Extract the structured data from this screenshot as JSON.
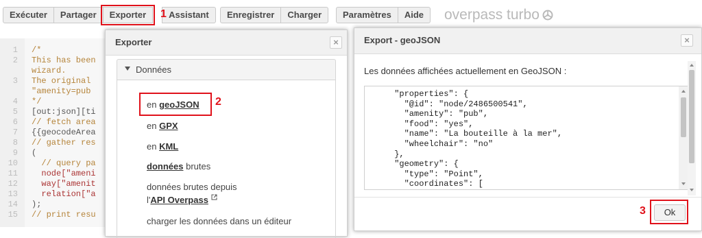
{
  "toolbar": {
    "run": "Exécuter",
    "share": "Partager",
    "export": "Exporter",
    "wizard": "Assistant",
    "save": "Enregistrer",
    "load": "Charger",
    "settings": "Paramètres",
    "help": "Aide"
  },
  "app_title": "overpass turbo",
  "callouts": {
    "one": "1",
    "two": "2",
    "three": "3"
  },
  "editor": {
    "lines": [
      {
        "n": "1",
        "text": "/*"
      },
      {
        "n": "2",
        "text": "This has been"
      },
      {
        "n": "",
        "text": "wizard."
      },
      {
        "n": "3",
        "text": "The original"
      },
      {
        "n": "",
        "text": "\"amenity=pub"
      },
      {
        "n": "4",
        "text": "*/"
      },
      {
        "n": "5",
        "text": "[out:json][ti"
      },
      {
        "n": "6",
        "text": "// fetch area"
      },
      {
        "n": "7",
        "text": "{{geocodeArea"
      },
      {
        "n": "8",
        "text": "// gather res"
      },
      {
        "n": "9",
        "text": "("
      },
      {
        "n": "10",
        "text": "  // query pa"
      },
      {
        "n": "11",
        "text": "  node[\"ameni"
      },
      {
        "n": "12",
        "text": "  way[\"amenit"
      },
      {
        "n": "13",
        "text": "  relation[\"a"
      },
      {
        "n": "14",
        "text": ");"
      },
      {
        "n": "15",
        "text": "// print resu"
      }
    ]
  },
  "export_dialog": {
    "title": "Exporter",
    "section": "Données",
    "options": {
      "geojson_prefix": "en",
      "geojson": "geoJSON",
      "gpx_prefix": "en",
      "gpx": "GPX",
      "kml_prefix": "en",
      "kml": "KML",
      "raw": "données",
      "raw_suffix": "brutes",
      "raw_api_line1": "données brutes depuis",
      "raw_api_prefix": "l'",
      "raw_api": "API Overpass",
      "load_editor": "charger les données dans un éditeur"
    }
  },
  "geojson_dialog": {
    "title": "Export - geoJSON",
    "intro": "Les données affichées actuellement en GeoJSON :",
    "code_lines": [
      "      \"properties\": {",
      "        \"@id\": \"node/2486500541\",",
      "        \"amenity\": \"pub\",",
      "        \"food\": \"yes\",",
      "        \"name\": \"La bouteille à la mer\",",
      "        \"wheelchair\": \"no\"",
      "      },",
      "      \"geometry\": {",
      "        \"type\": \"Point\",",
      "        \"coordinates\": ["
    ],
    "ok": "Ok"
  },
  "colors": {
    "annotation": "#e0111a"
  }
}
